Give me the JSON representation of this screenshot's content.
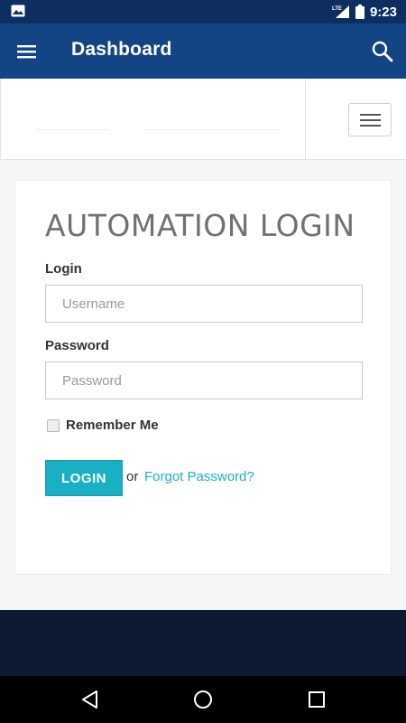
{
  "status_bar": {
    "time": "9:23",
    "network": "LTE",
    "icons": [
      "image-notification-icon",
      "lte-signal-icon",
      "battery-icon"
    ]
  },
  "app_bar": {
    "title": "Dashboard",
    "menu_icon": "hamburger-menu-icon",
    "search_icon": "search-icon",
    "color": "#134585"
  },
  "site_header": {
    "nav_toggle_icon": "hamburger-menu-icon"
  },
  "login": {
    "title": "AUTOMATION LOGIN",
    "login_label": "Login",
    "username_placeholder": "Username",
    "username_value": "",
    "password_label": "Password",
    "password_placeholder": "Password",
    "password_value": "",
    "remember_label": "Remember Me",
    "remember_checked": false,
    "submit_label": "LOGIN",
    "or_text": "or",
    "forgot_label": "Forgot Password?",
    "accent_color": "#1ab0c4"
  },
  "nav_bar": {
    "icons": [
      "back-icon",
      "home-icon",
      "recent-apps-icon"
    ]
  }
}
